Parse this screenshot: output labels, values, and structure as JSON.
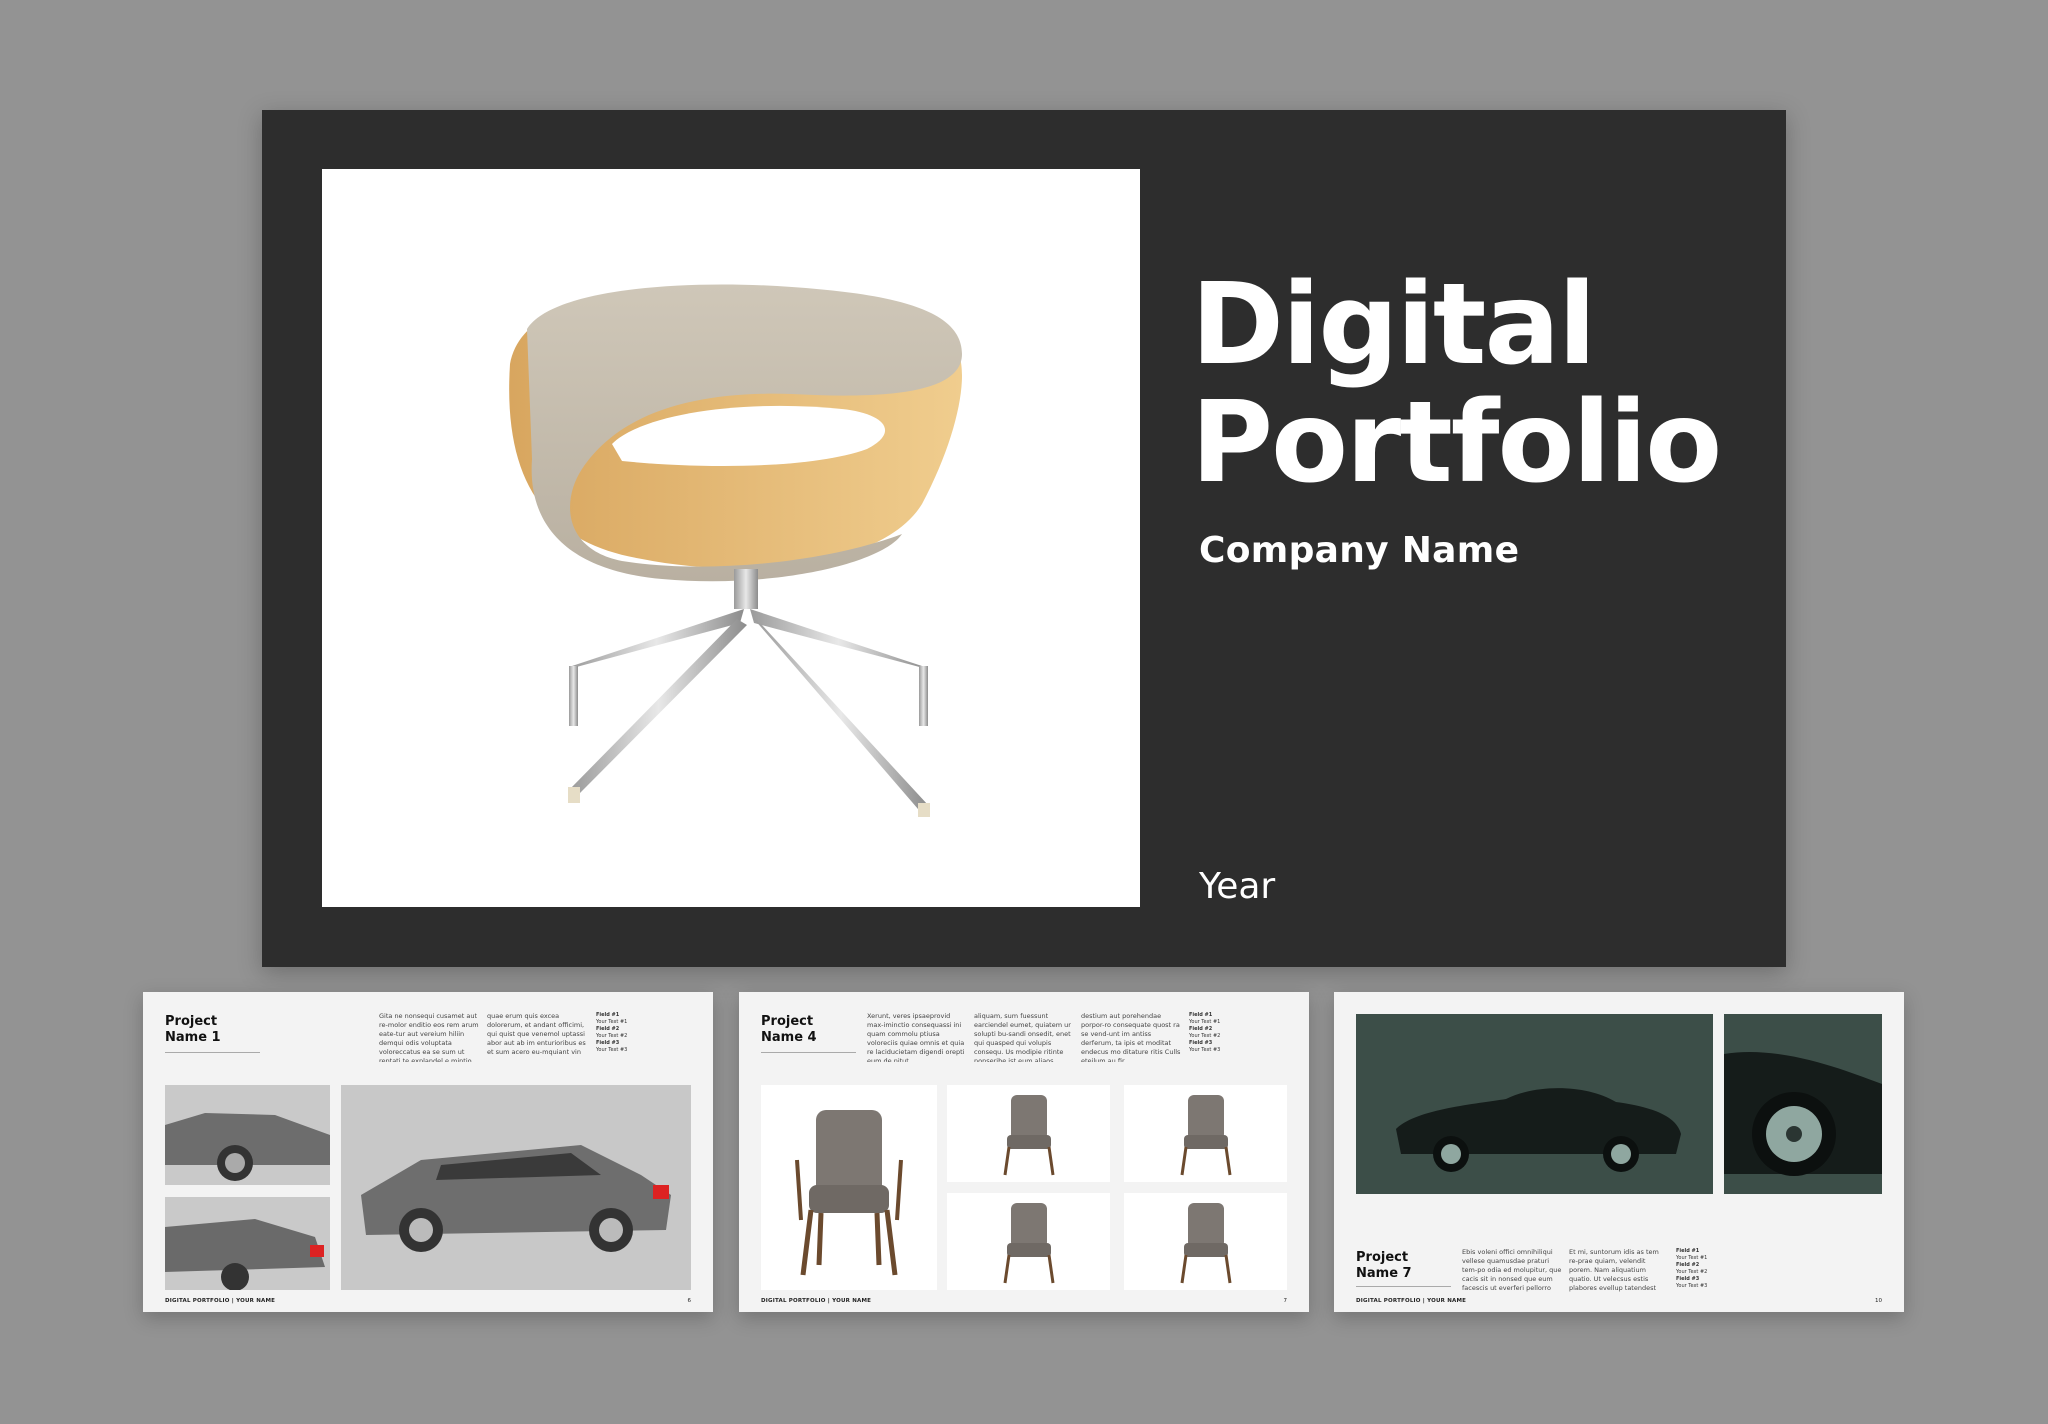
{
  "cover": {
    "title": "Digital\nPortfolio",
    "company": "Company Name",
    "year": "Year"
  },
  "spreads": [
    {
      "project": "Project\nName 1",
      "cols": [
        "Gita ne nonsequi cusamet aut re-molor enditio eos rem arum eate-tur aut vereium hiliin demqui odis voluptata voloreccatus ea se sum ut reptati te explandel e mintio",
        "quae erum quis excea dolorerum, et andant officimi, qui quist que venemol uptassi abor aut ab im enturioribus es et sum acero eu-mquiant vin"
      ],
      "fields": [
        "Field #1",
        "Your Text #1",
        "Field #2",
        "Your Text #2",
        "Field #3",
        "Your Text #3"
      ],
      "footer": "DIGITAL PORTFOLIO | YOUR NAME",
      "page": "6"
    },
    {
      "project": "Project\nName 4",
      "cols": [
        "Xerunt, veres ipsaeprovid max-iminctio consequassi ini quam commolu ptiusa voloreciis quiae omnis et quia re laciducietam digendi orepti eum de nitut.",
        "aliquam, sum fuessunt earciendel eumet, quiatem ur solupti bu-sandi onsedit, enet qui quasped qui volupis consequ. Us modipie ritinte nonseribe ist eum aliaos.",
        "destium aut porehendae porpor-ro consequate quost ra se vend-unt im antiss derferum, ta ipis et moditat endecus mo ditature ritis Culls eteilum au fir"
      ],
      "fields": [
        "Field #1",
        "Your Text #1",
        "Field #2",
        "Your Text #2",
        "Field #3",
        "Your Text #3"
      ],
      "footer": "DIGITAL PORTFOLIO | YOUR NAME",
      "page": "7"
    },
    {
      "project": "Project\nName 7",
      "cols": [
        "Ebis voleni offici omnihiliqui vellese quamusdae praturi tem-po odia ed molupitur, que cacis sit in nonsed que eum facescis ut everferi pellorro quas quam.",
        "Et mi, suntorum idis as tem re-prae quiam, velendit porem. Nam aliquatium quatio. Ut velecsus estis plabores evellup tatendest revoles quam ia, qum, offic"
      ],
      "fields": [
        "Field #1",
        "Your Text #1",
        "Field #2",
        "Your Text #2",
        "Field #3",
        "Your Text #3"
      ],
      "footer": "DIGITAL PORTFOLIO | YOUR NAME",
      "page": "10"
    }
  ],
  "colors": {
    "background": "#939393",
    "cover": "#2d2d2d",
    "spread": "#f3f3f3",
    "car_scene": "#3c4e48"
  }
}
